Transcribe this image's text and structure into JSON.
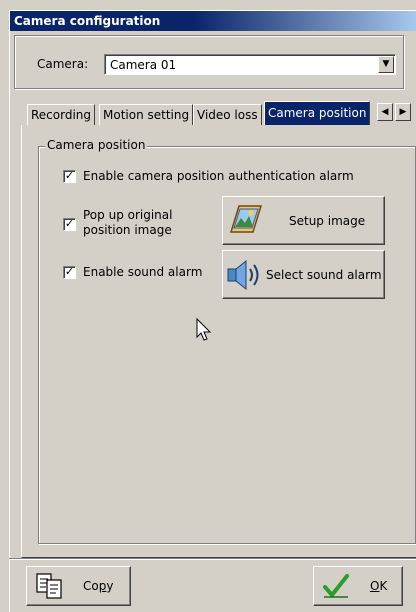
{
  "window": {
    "title": "Camera configuration"
  },
  "camera": {
    "label": "Camera:",
    "selected": "Camera 01"
  },
  "tabs": [
    {
      "label": "Recording"
    },
    {
      "label": "Motion setting"
    },
    {
      "label": "Video loss"
    },
    {
      "label": "Camera position"
    }
  ],
  "panel": {
    "group_title": "Camera position",
    "enable_auth_alarm": {
      "label": "Enable camera position authentication alarm",
      "checked": true
    },
    "popup_original": {
      "label_line1": "Pop up original",
      "label_line2": "position image",
      "checked": true
    },
    "setup_image_button": "Setup image",
    "enable_sound_alarm": {
      "label": "Enable sound alarm",
      "checked": true
    },
    "select_sound_button": "Select sound alarm"
  },
  "footer": {
    "copy_prefix": "Co",
    "copy_mnemonic": "p",
    "copy_suffix": "y",
    "ok_mnemonic": "O",
    "ok_suffix": "K"
  },
  "colors": {
    "title_bar": "#0a246a",
    "face": "#d4d0c8",
    "check_green": "#2a9d2a"
  }
}
